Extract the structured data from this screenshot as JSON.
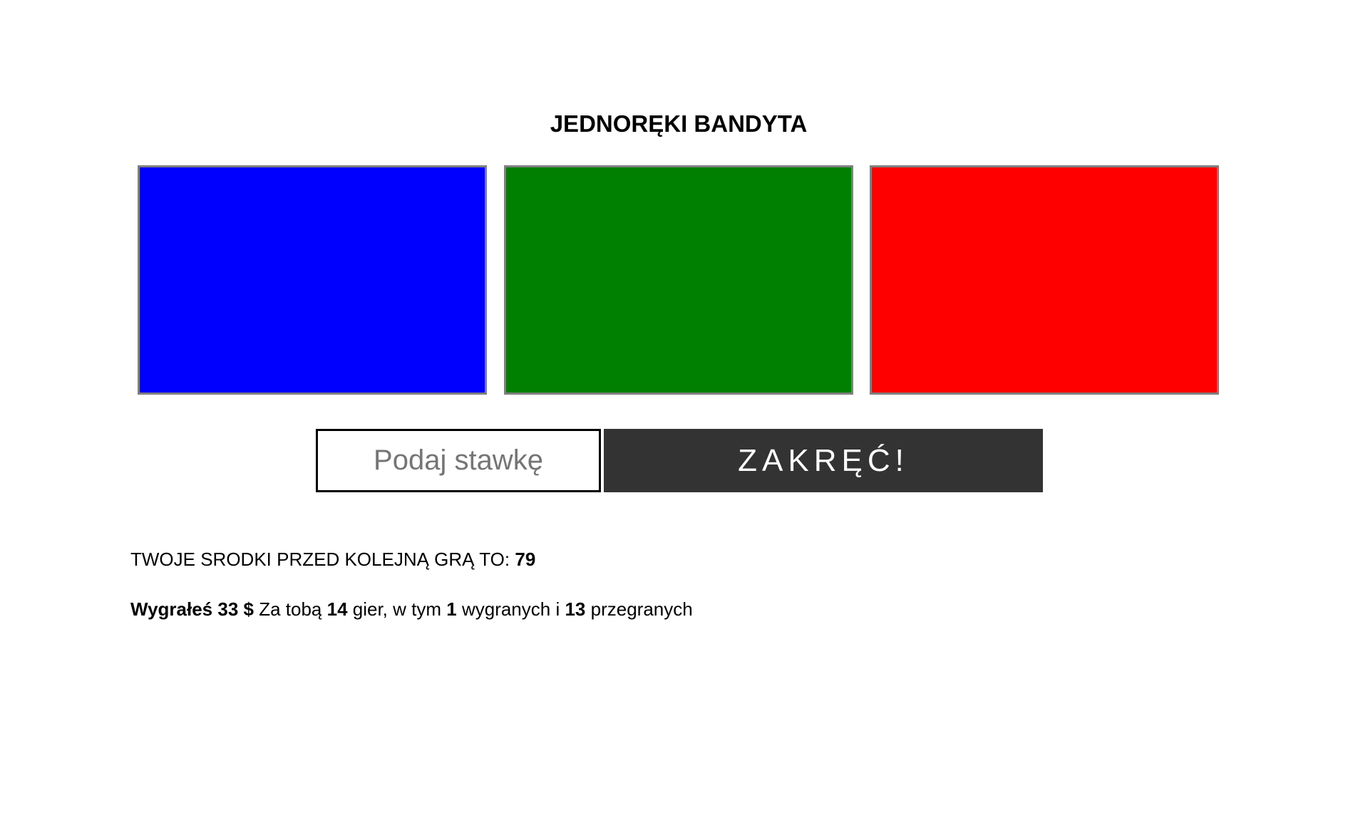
{
  "title": "JEDNORĘKI BANDYTA",
  "reels": [
    {
      "color": "#0000ff"
    },
    {
      "color": "#008000"
    },
    {
      "color": "#ff0000"
    }
  ],
  "bet_input": {
    "placeholder": "Podaj stawkę",
    "value": ""
  },
  "spin_button": {
    "label": "ZAKRĘĆ!"
  },
  "funds": {
    "label": "TWOJE SRODKI PRZED KOLEJNĄ GRĄ TO:",
    "value": "79"
  },
  "stats": {
    "result_text": "Wygrałeś 33 $",
    "games_prefix": "Za tobą",
    "games_count": "14",
    "games_middle": "gier, w tym",
    "wins_count": "1",
    "wins_middle": "wygranych i",
    "losses_count": "13",
    "losses_suffix": "przegranych"
  }
}
